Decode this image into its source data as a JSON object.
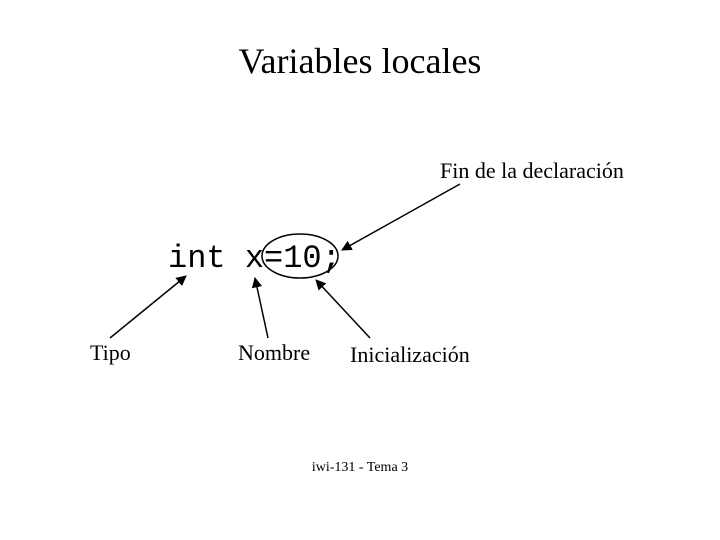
{
  "title": "Variables locales",
  "fin_label": "Fin de la declaración",
  "code": "int x=10;",
  "tipo_label": "Tipo",
  "nombre_label": "Nombre",
  "inic_label": "Inicialización",
  "footer": "iwi-131 - Tema 3"
}
